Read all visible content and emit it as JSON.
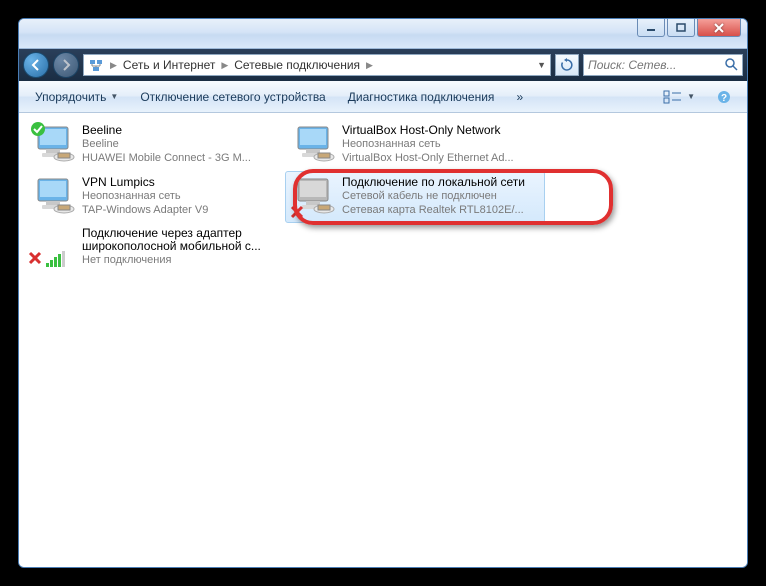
{
  "titlebar": {},
  "nav": {
    "crumbs": [
      "Сеть и Интернет",
      "Сетевые подключения"
    ]
  },
  "search": {
    "placeholder": "Поиск: Сетев..."
  },
  "toolbar": {
    "organize": "Упорядочить",
    "disable": "Отключение сетевого устройства",
    "diagnose": "Диагностика подключения",
    "more": "»"
  },
  "items": [
    {
      "name": "Beeline",
      "line2": "Beeline",
      "line3": "HUAWEI Mobile Connect - 3G M...",
      "status": "connected"
    },
    {
      "name": "VirtualBox Host-Only Network",
      "line2": "Неопознанная сеть",
      "line3": "VirtualBox Host-Only Ethernet Ad...",
      "status": "ok"
    },
    {
      "name": "VPN Lumpics",
      "line2": "Неопознанная сеть",
      "line3": "TAP-Windows Adapter V9",
      "status": "ok"
    },
    {
      "name": "Подключение по локальной сети",
      "line2": "Сетевой кабель не подключен",
      "line3": "Сетевая карта Realtek RTL8102E/...",
      "status": "disconnected",
      "selected": true
    },
    {
      "name": "Подключение через адаптер широкополосной мобильной с...",
      "line2": "Нет подключения",
      "line3": "",
      "status": "no-signal"
    }
  ]
}
